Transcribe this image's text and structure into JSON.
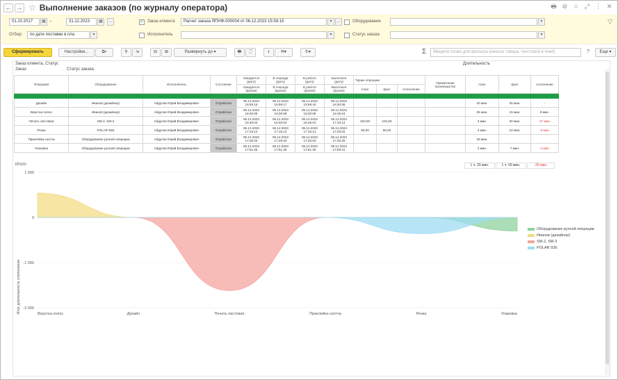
{
  "window": {
    "title": "Выполнение заказов (по журналу оператора)",
    "nav_back": "←",
    "nav_forward": "→"
  },
  "filters": {
    "date_from": "01.10.2017",
    "date_to": "31.12.2023",
    "period_sep": "–",
    "selection_label": "Отбор:",
    "selection_value": "по дате поставки в пла",
    "client_order_label": "Заказ клиента",
    "client_order_value": "Расчет заказа ЯПНФ-000004 от 06.12.2023 15:59:15",
    "executor_label": "Исполнитель",
    "executor_value": "",
    "equipment_label": "Оборудование",
    "equipment_value": "",
    "order_status_label": "Статус заказа",
    "order_status_value": ""
  },
  "toolbar": {
    "generate_label": "Сформировать",
    "settings_label": "Настройки...",
    "expand_label": "Развернуть до",
    "search_placeholder": "Введите слово для фильтра (начало товара, текстовой в ячей)",
    "help_label": "?",
    "more_label": "Еще",
    "sigma_label": "Σ"
  },
  "report": {
    "groups_line1": "Заказ клиента, Статус",
    "groups_line2": "Заказ",
    "groups_line2b": "Статус заказа",
    "duration_label": "Длительность",
    "columns": {
      "operation": "Операция",
      "equipment": "Оборудование",
      "executor": "Исполнитель",
      "state": "Состояние",
      "expected_l1": "Ожидается",
      "expected_l2": "(дата)",
      "queue_l1": "В очереди",
      "queue_l2": "(дата)",
      "inwork_l1": "В работе",
      "inwork_l2": "(дата)",
      "done_l1": "Выполнен",
      "done_l2": "(дата)",
      "expected_t1": "Ожидается",
      "expected_t2": "(время)",
      "queue_t1": "В очереди",
      "queue_t2": "(время)",
      "inwork_t1": "В работе",
      "inwork_t2": "(время)",
      "done_t1": "Выполнен",
      "done_t2": "(время)",
      "raw_ops": "Тираж операции",
      "plan": "план",
      "fact": "факт",
      "deviation": "отклонение",
      "note_l1": "Примечание",
      "note_l2": "производства",
      "dur_plan": "план",
      "dur_fact": "факт",
      "dur_dev": "отклонение"
    },
    "rows": [
      {
        "op": "Дизайн",
        "eq": "Иванов (дизайнер)",
        "ex": "Абдулов Юрий Владимирович",
        "st": "Отработан",
        "d1": "06.12.2023",
        "t1": "15:59:16",
        "d2": "06.12.2023",
        "t2": "15:59:17",
        "d3": "06.12.2023",
        "t3": "15:59:42",
        "d4": "06.12.2023",
        "t4": "16:30:08",
        "rp": "",
        "rf": "",
        "rd": "",
        "pp": "30 мин.",
        "pf": "30 мин.",
        "pd": "-",
        "neg": false
      },
      {
        "op": "Верстка полос",
        "eq": "Иванов (дизайнер)",
        "ex": "Абдулов Юрий Владимирович",
        "st": "Отработан",
        "d1": "06.12.2023",
        "t1": "16:30:08",
        "d2": "06.12.2023",
        "t2": "16:30:08",
        "d3": "06.12.2023",
        "t3": "16:30:08",
        "d4": "06.12.2023",
        "t4": "16:45:04",
        "rp": "",
        "rf": "",
        "rd": "",
        "pp": "25 мин.",
        "pf": "15 мин.",
        "pd": "9 мин.",
        "neg": false
      },
      {
        "op": "Печать листовая",
        "eq": "SM-2, SM-3",
        "ex": "Абдулов Юрий Владимирович",
        "st": "Отработан",
        "d1": "06.12.2023",
        "t1": "16:45:04",
        "d2": "06.12.2023",
        "t2": "16:45:04",
        "d3": "06.12.2023",
        "t3": "16:45:04",
        "d4": "06.12.2023",
        "t4": "17:15:14",
        "rp": "102,00",
        "rf": "102,00",
        "rd": "",
        "pp": "3 мин.",
        "pf": "30 мин.",
        "pd": "-27 мин.",
        "neg": true
      },
      {
        "op": "Резка",
        "eq": "POLAR 92E",
        "ex": "Абдулов Юрий Владимирович",
        "st": "Отработан",
        "d1": "06.12.2023",
        "t1": "17:15:14",
        "d2": "06.12.2023",
        "t2": "17:15:14",
        "d3": "06.12.2023",
        "t3": "17:15:14",
        "d4": "06.12.2023",
        "t4": "17:25:04",
        "rp": "50,00",
        "rf": "50,00",
        "rd": "",
        "pp": "4 мин.",
        "pf": "10 мин.",
        "pd": "-6 мин.",
        "neg": true
      },
      {
        "op": "Приклейка скотча",
        "eq": "Оборудование ручной операции",
        "ex": "Абдулов Юрий Владимирович",
        "st": "Отработан",
        "d1": "06.12.2023",
        "t1": "17:25:04",
        "d2": "06.12.2023",
        "t2": "17:25:04",
        "d3": "06.12.2023",
        "t3": "17:25:04",
        "d4": "06.12.2023",
        "t4": "17:25:25",
        "rp": "",
        "rf": "",
        "rd": "",
        "pp": "28 мин.",
        "pf": "",
        "pd": "",
        "neg": false
      },
      {
        "op": "Упаковка",
        "eq": "Оборудование ручной операции",
        "ex": "Абдулов Юрий Владимирович",
        "st": "Отработан",
        "d1": "06.12.2023",
        "t1": "17:51:25",
        "d2": "06.12.2023",
        "t2": "17:51:25",
        "d3": "06.12.2023",
        "t3": "17:51:25",
        "d4": "06.12.2023",
        "t4": "17:59:41",
        "rp": "",
        "rf": "",
        "rd": "",
        "pp": "2 мин.",
        "pf": "7 мин.",
        "pd": "-4 мин.",
        "neg": true
      }
    ],
    "total_label": "Итого",
    "total_plan": "1 ч. 29 мин.",
    "total_fact": "1 ч. 59 мин.",
    "total_dev": "-30 мин."
  },
  "chart_data": {
    "type": "area",
    "ylabel": "Итог длительность отклонение",
    "categories": [
      "Верстка полос",
      "Дизайн",
      "Печать листовая",
      "Приклейка скотча",
      "Резка",
      "Упаковка"
    ],
    "yticks": [
      "1 000",
      "0",
      "-1 000",
      "-2 000"
    ],
    "ylim": [
      -2000,
      1000
    ],
    "series": [
      {
        "name": "Оборудование ручной операции",
        "color": "#8fd19e",
        "values": [
          0,
          0,
          0,
          0,
          0,
          -300
        ]
      },
      {
        "name": "Иванов (дизайнер)",
        "color": "#f3dc84",
        "values": [
          540,
          0,
          0,
          0,
          0,
          0
        ]
      },
      {
        "name": "SM-2, SM-3",
        "color": "#f5a5a0",
        "values": [
          0,
          0,
          -1620,
          0,
          0,
          0
        ]
      },
      {
        "name": "POLAR 92E",
        "color": "#9fdcf3",
        "values": [
          0,
          0,
          0,
          0,
          -360,
          0
        ]
      }
    ]
  }
}
